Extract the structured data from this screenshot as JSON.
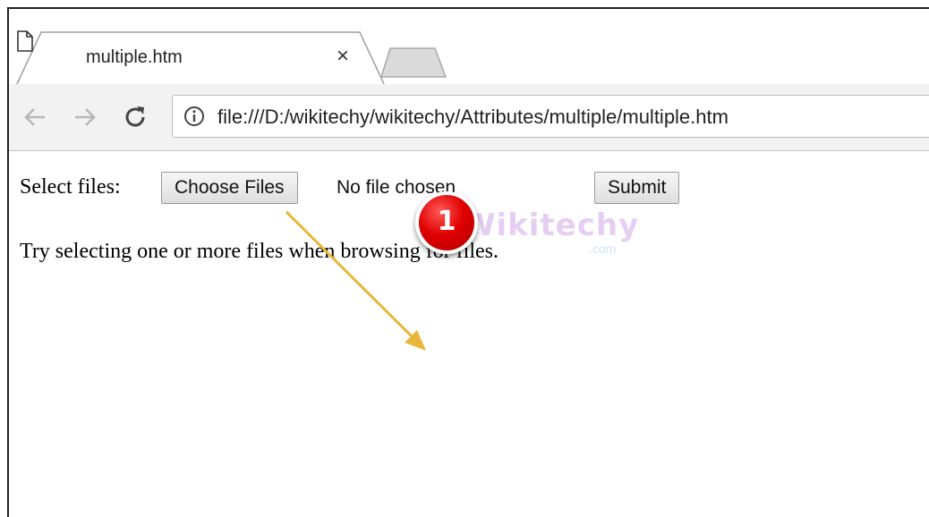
{
  "tab": {
    "title": "multiple.htm",
    "close_glyph": "×",
    "favicon": "page-icon"
  },
  "toolbar": {
    "back_icon": "arrow-left-icon",
    "forward_icon": "arrow-right-icon",
    "reload_icon": "reload-icon",
    "url": "file:///D:/wikitechy/wikitechy/Attributes/multiple/multiple.htm"
  },
  "page": {
    "select_label": "Select files:",
    "choose_button": "Choose Files",
    "no_file_text": "No file chosen",
    "submit_button": "Submit",
    "instructions": "Try selecting one or more files when browsing for files."
  },
  "watermark": {
    "logo": "Wikitechy",
    "suffix": ".com"
  },
  "annotation": {
    "badge_number": "1",
    "arrow_color": "#e8b63a",
    "badge_color": "#e00000"
  }
}
